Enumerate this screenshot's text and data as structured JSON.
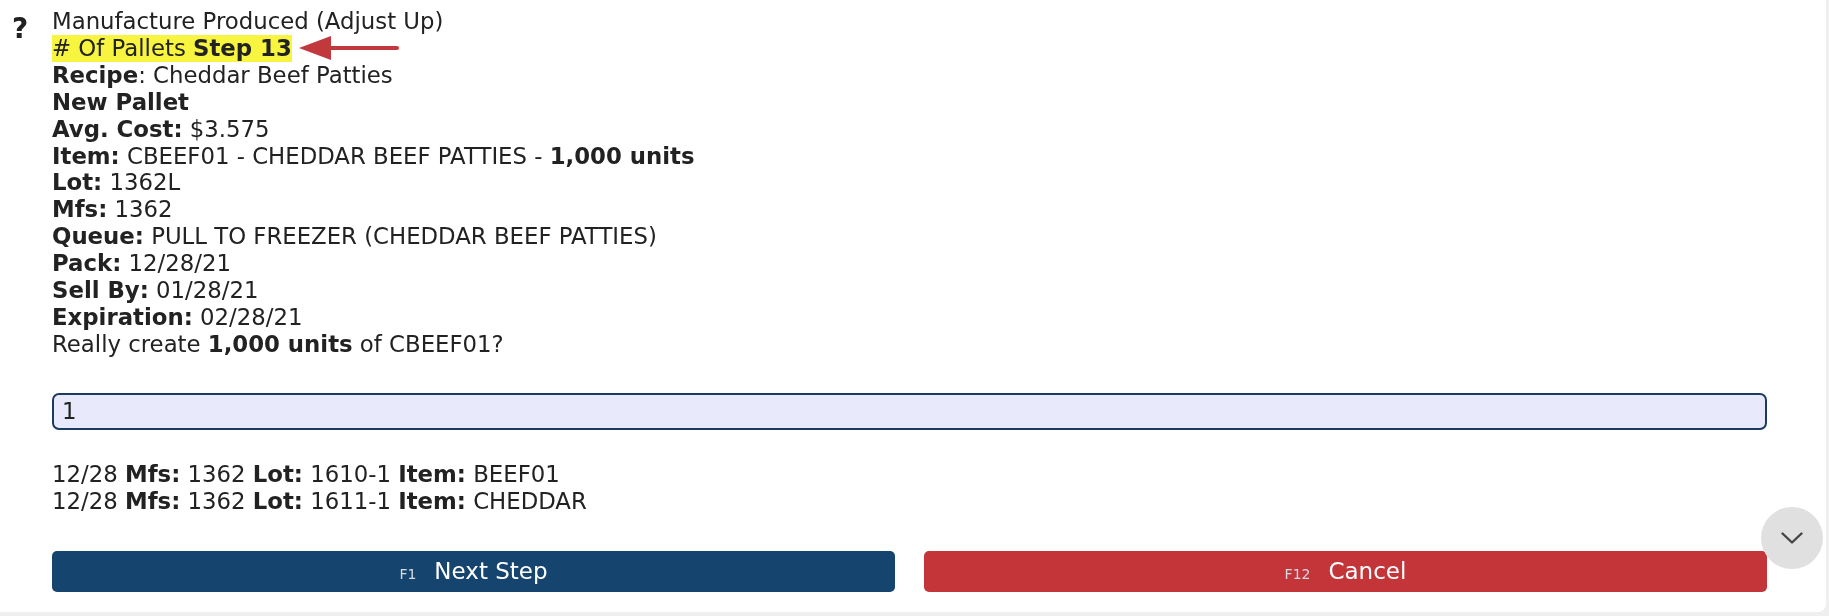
{
  "help_mark": "?",
  "title": "Manufacture Produced (Adjust Up)",
  "prompt": {
    "text": "# Of Pallets **Step 13**",
    "highlighted": true
  },
  "details": [
    {
      "kind": "line",
      "text": "**Recipe**: Cheddar Beef Patties"
    },
    {
      "kind": "heading",
      "text": "New Pallet"
    },
    {
      "kind": "line",
      "text": "**Avg. Cost:** $3.575"
    },
    {
      "kind": "line",
      "text": "**Item:** CBEEF01 - CHEDDAR BEEF PATTIES - **1,000 units**"
    },
    {
      "kind": "line",
      "text": "**Lot:** 1362L"
    },
    {
      "kind": "line",
      "text": "**Mfs:** 1362"
    },
    {
      "kind": "line",
      "text": "**Queue:** PULL TO FREEZER (CHEDDAR BEEF PATTIES)"
    },
    {
      "kind": "line",
      "text": "**Pack:** 12/28/21"
    },
    {
      "kind": "line",
      "text": "**Sell By:** 01/28/21"
    },
    {
      "kind": "line",
      "text": "**Expiration:** 02/28/21"
    },
    {
      "kind": "line",
      "text": "Really create **1,000 units** of CBEEF01?"
    }
  ],
  "input": {
    "value": "1"
  },
  "components": [
    "12/28 **Mfs:** 1362 **Lot:** 1610-1 **Item:** BEEF01",
    "12/28 **Mfs:** 1362 **Lot:** 1611-1 **Item:** CHEDDAR"
  ],
  "buttons": [
    {
      "kind": "primary",
      "key": "F1",
      "label": "Next Step"
    },
    {
      "kind": "danger",
      "key": "F12",
      "label": "Cancel"
    }
  ]
}
